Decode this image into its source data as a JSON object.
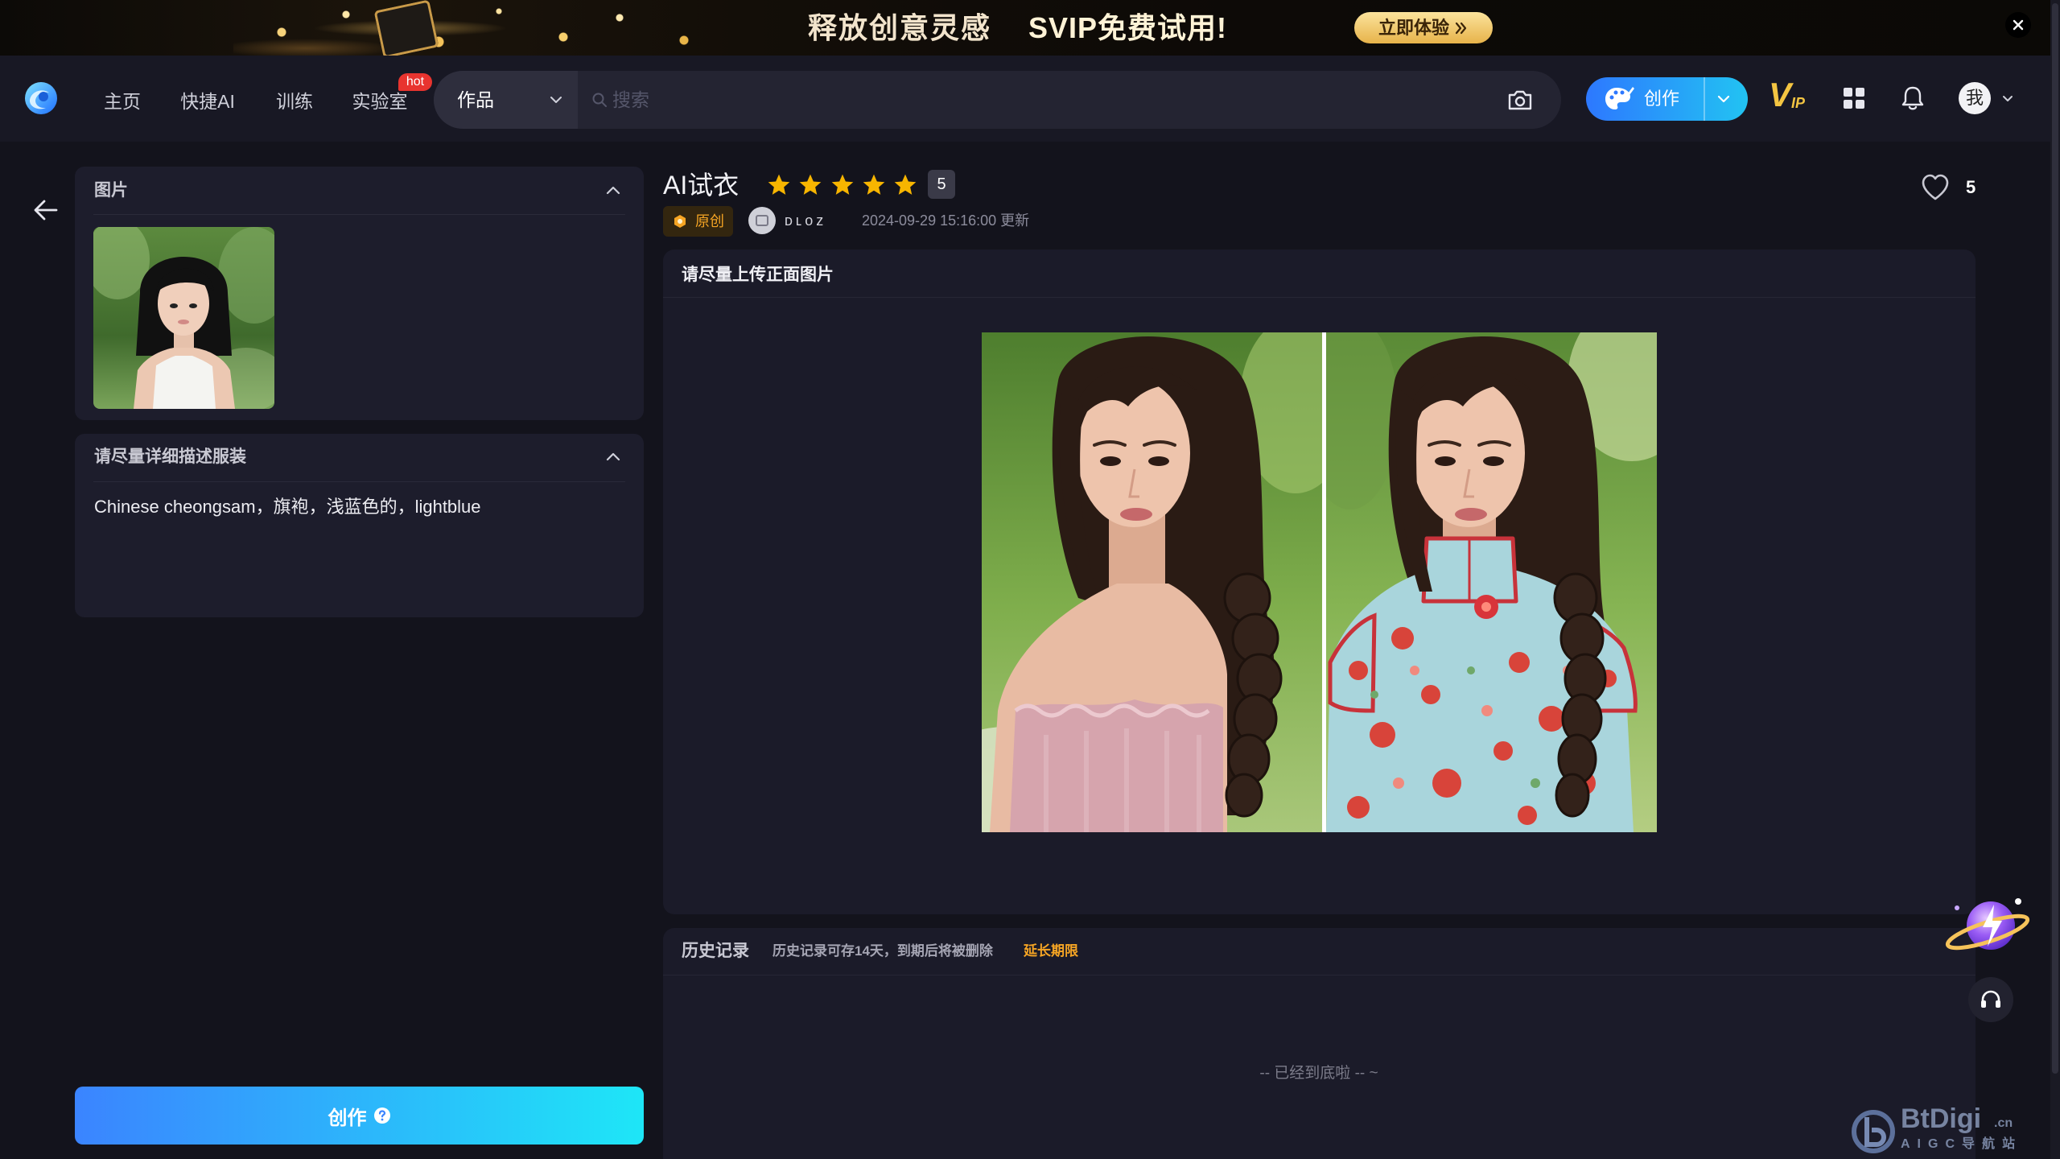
{
  "banner": {
    "headline": "释放创意灵感",
    "promo": "SVIP免费试用!",
    "cta_label": "立即体验"
  },
  "nav": {
    "items": [
      {
        "label": "主页"
      },
      {
        "label": "快捷AI"
      },
      {
        "label": "训练"
      },
      {
        "label": "实验室"
      }
    ],
    "hot_badge": "hot"
  },
  "search": {
    "scope": "作品",
    "placeholder": "搜索"
  },
  "toolbar": {
    "create_label": "创作",
    "vip_logo": {
      "v": "V",
      "ip": "IP"
    },
    "avatar_label": "我"
  },
  "sidebar": {
    "image_panel_title": "图片",
    "prompt_panel_title": "请尽量详细描述服装",
    "prompt_value": "Chinese cheongsam，旗袍，浅蓝色的，lightblue",
    "submit_label": "创作"
  },
  "work": {
    "title": "AI试衣",
    "rating": 5,
    "rating_badge": "5",
    "tag": "原创",
    "author": "ᴅʟᴏᴢ",
    "updated": "2024-09-29 15:16:00 更新",
    "likes": "5"
  },
  "preview": {
    "title": "请尽量上传正面图片"
  },
  "history": {
    "title": "历史记录",
    "note": "历史记录可存14天，到期后将被删除",
    "extend_label": "延长期限",
    "end_text": "-- 已经到底啦 -- ~"
  },
  "watermark": {
    "brand": "BtDigi",
    "tld": ".cn",
    "subtitle": "AIGC导航站"
  },
  "colors": {
    "background": "#13131c",
    "card": "#1b1b29",
    "accent_blue": "#2d78ff",
    "accent_cyan": "#1ee6f7",
    "star": "#f7b500",
    "star_off": "#4a4a58",
    "orange": "#f6a524",
    "hot": "#e8342f"
  },
  "icons": [
    "close-icon",
    "double-chevron-right-icon",
    "app-logo-icon",
    "chevron-down-icon",
    "search-icon",
    "camera-icon",
    "palette-icon",
    "grid-icon",
    "bell-icon",
    "back-arrow-icon",
    "chevron-up-icon",
    "help-icon",
    "star-icon",
    "heart-icon",
    "original-badge-icon",
    "headset-icon"
  ]
}
